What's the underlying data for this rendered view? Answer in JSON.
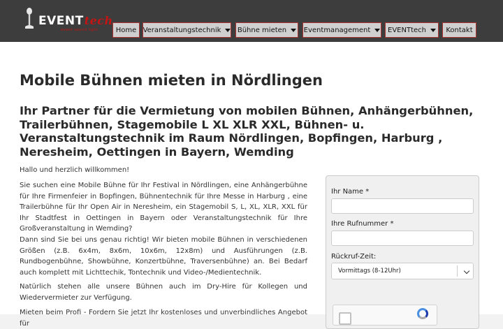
{
  "header": {
    "logo": {
      "brand": "EVENT",
      "brand_accent": "tech",
      "tagline": "event sound light"
    },
    "nav": [
      {
        "label": "Home",
        "dropdown": false
      },
      {
        "label": "Veranstaltungstechnik",
        "dropdown": true
      },
      {
        "label": "Bühne mieten",
        "dropdown": true
      },
      {
        "label": "Eventmanagement",
        "dropdown": true
      },
      {
        "label": "EVENTtech",
        "dropdown": true
      },
      {
        "label": "Kontakt",
        "dropdown": false
      }
    ]
  },
  "main": {
    "title": "Mobile Bühnen mieten in Nördlingen",
    "subtitle": "Ihr Partner für die Vermietung von mobilen Bühnen, Anhängerbühnen, Trailerbühnen, Stagemobile L XL XLR XXL, Bühnen- u. Veranstaltungstechnik im Raum Nördlingen, Bopfingen, Harburg , Neresheim, Oettingen in Bayern, Wemding",
    "paragraphs": [
      "Hallo und herzlich willkommen!",
      "Sie suchen eine Mobile Bühne für Ihr Festival in Nördlingen, eine Anhängerbühne für Ihre Firmenfeier in Bopfingen, Bühnentechnik für Ihre Messe in Harburg , eine Trailerbühne für Ihr Open Air in Neresheim, ein Stagemobil S, L, XL, XLR, XXL für Ihr Stadtfest in Oettingen in Bayern oder Veranstaltungstechnik für Ihre Großveranstaltung in Wemding?",
      "Dann sind Sie bei uns genau richtig! Wir bieten mobile Bühnen in verschiedenen Größen (z.B. 6x4m, 8x6m, 10x6m, 12x8m) und Ausführungen (z.B. Rundbogenbühne, Showbühne, Konzertbühne, Traversenbühne) an. Bei Bedarf auch komplett mit Lichttechik, Tontechnik und Video-/Medientechnik.",
      "Natürlich stehen alle unsere Bühnen auch im Dry-Hire für Kollegen und Wiedervermieter zur Verfügung.",
      "Mieten beim Profi - Fordern Sie jetzt Ihr kostenloses und unverbindliches Angebot für"
    ]
  },
  "form": {
    "name_label": "Ihr Name *",
    "name_value": "",
    "phone_label": "Ihre Rufnummer *",
    "phone_value": "",
    "callback_label": "Rückruf-Zeit:",
    "callback_selected": "Vormittags (8-12Uhr)"
  },
  "colors": {
    "topbar": "#3d3d3d",
    "accent": "#c41414",
    "nav_bg": "#d0d0d0"
  }
}
